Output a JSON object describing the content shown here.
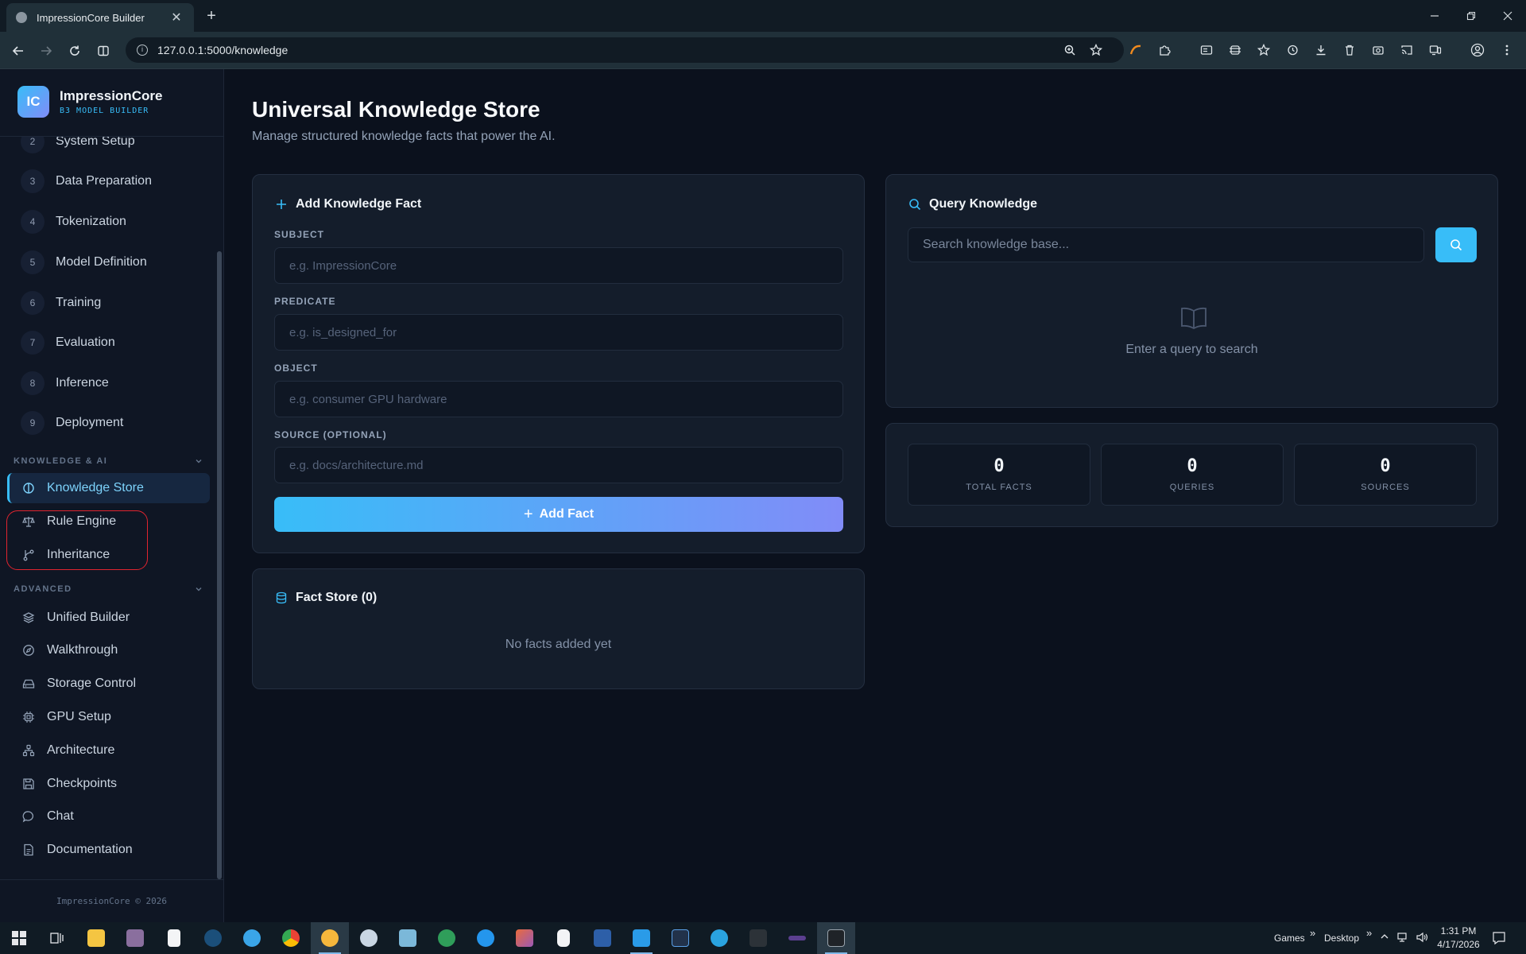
{
  "browser": {
    "tab_title": "ImpressionCore Builder",
    "url": "127.0.0.1:5000/knowledge"
  },
  "brand": {
    "logo_text": "IC",
    "name": "ImpressionCore",
    "subtitle": "B3 MODEL BUILDER"
  },
  "sidebar": {
    "steps": [
      {
        "num": "2",
        "label": "System Setup"
      },
      {
        "num": "3",
        "label": "Data Preparation"
      },
      {
        "num": "4",
        "label": "Tokenization"
      },
      {
        "num": "5",
        "label": "Model Definition"
      },
      {
        "num": "6",
        "label": "Training"
      },
      {
        "num": "7",
        "label": "Evaluation"
      },
      {
        "num": "8",
        "label": "Inference"
      },
      {
        "num": "9",
        "label": "Deployment"
      }
    ],
    "section_knowledge": "KNOWLEDGE & AI",
    "knowledge_items": [
      {
        "label": "Knowledge Store",
        "icon": "brain-icon",
        "active": true
      },
      {
        "label": "Rule Engine",
        "icon": "scale-icon"
      },
      {
        "label": "Inheritance",
        "icon": "git-branch-icon"
      }
    ],
    "section_advanced": "ADVANCED",
    "advanced_items": [
      {
        "label": "Unified Builder",
        "icon": "layers-icon"
      },
      {
        "label": "Walkthrough",
        "icon": "compass-icon"
      },
      {
        "label": "Storage Control",
        "icon": "hard-drive-icon"
      },
      {
        "label": "GPU Setup",
        "icon": "cpu-icon"
      },
      {
        "label": "Architecture",
        "icon": "network-icon"
      },
      {
        "label": "Checkpoints",
        "icon": "save-icon"
      },
      {
        "label": "Chat",
        "icon": "chat-icon"
      },
      {
        "label": "Documentation",
        "icon": "document-icon"
      }
    ],
    "footer": "ImpressionCore © 2026"
  },
  "page": {
    "title": "Universal Knowledge Store",
    "subtitle": "Manage structured knowledge facts that power the AI."
  },
  "add_fact": {
    "title": "Add Knowledge Fact",
    "subject_label": "SUBJECT",
    "subject_placeholder": "e.g. ImpressionCore",
    "subject_value": "",
    "predicate_label": "PREDICATE",
    "predicate_placeholder": "e.g. is_designed_for",
    "predicate_value": "",
    "object_label": "OBJECT",
    "object_placeholder": "e.g. consumer GPU hardware",
    "object_value": "",
    "source_label": "SOURCE (OPTIONAL)",
    "source_placeholder": "e.g. docs/architecture.md",
    "source_value": "",
    "button_label": "Add Fact"
  },
  "fact_store": {
    "title": "Fact Store (0)",
    "empty_text": "No facts added yet"
  },
  "query": {
    "title": "Query Knowledge",
    "placeholder": "Search knowledge base...",
    "value": "",
    "empty_text": "Enter a query to search"
  },
  "stats": [
    {
      "value": "0",
      "label": "TOTAL FACTS"
    },
    {
      "value": "0",
      "label": "QUERIES"
    },
    {
      "value": "0",
      "label": "SOURCES"
    }
  ],
  "colors": {
    "accent": "#38bdf8",
    "accent_gradient_end": "#818cf8",
    "background": "#0b111d",
    "card": "#141d2b",
    "annotation_outline": "#e0242f"
  },
  "taskbar": {
    "toolbar_label_1": "Games",
    "toolbar_label_2": "Desktop",
    "time": "1:31 PM",
    "date": "4/17/2026"
  }
}
